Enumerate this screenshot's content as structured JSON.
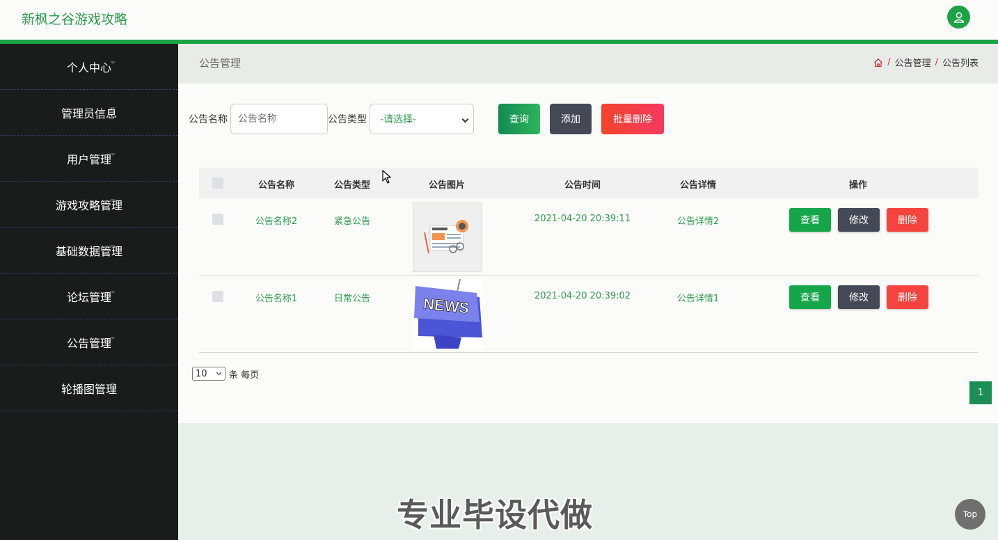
{
  "app": {
    "title": "新枫之谷游戏攻略"
  },
  "sidebar": {
    "items": [
      {
        "label": "个人中心"
      },
      {
        "label": "管理员信息"
      },
      {
        "label": "用户管理"
      },
      {
        "label": "游戏攻略管理"
      },
      {
        "label": "基础数据管理"
      },
      {
        "label": "论坛管理"
      },
      {
        "label": "公告管理"
      },
      {
        "label": "轮播图管理"
      }
    ]
  },
  "header": {
    "page_title": "公告管理",
    "breadcrumb": [
      "公告管理",
      "公告列表"
    ],
    "breadcrumb_sep": "/"
  },
  "search": {
    "name_label": "公告名称",
    "name_placeholder": "公告名称",
    "type_label": "公告类型",
    "type_selected": "-请选择-",
    "query_button": "查询",
    "add_button": "添加",
    "batch_delete_button": "批量删除"
  },
  "table": {
    "columns": [
      "公告名称",
      "公告类型",
      "公告图片",
      "公告时间",
      "公告详情",
      "操作"
    ],
    "rows": [
      {
        "name": "公告名称2",
        "type": "紧急公告",
        "image": "news-illustration",
        "time": "2021-04-20 20:39:11",
        "detail": "公告详情2",
        "actions": [
          "查看",
          "修改",
          "删除"
        ]
      },
      {
        "name": "公告名称1",
        "type": "日常公告",
        "image": "news-key",
        "image_text": "NEWS",
        "time": "2021-04-20 20:39:02",
        "detail": "公告详情1",
        "actions": [
          "查看",
          "修改",
          "删除"
        ]
      }
    ]
  },
  "pagination": {
    "page_size": "10",
    "page_size_suffix": "条 每页",
    "current_page": "1"
  },
  "watermark": "专业毕设代做",
  "top_button": "Top",
  "colors": {
    "accent": "#1ba345",
    "sidebar_bg": "#1a1c1b",
    "danger": "#f5433e",
    "dark": "#454955"
  }
}
